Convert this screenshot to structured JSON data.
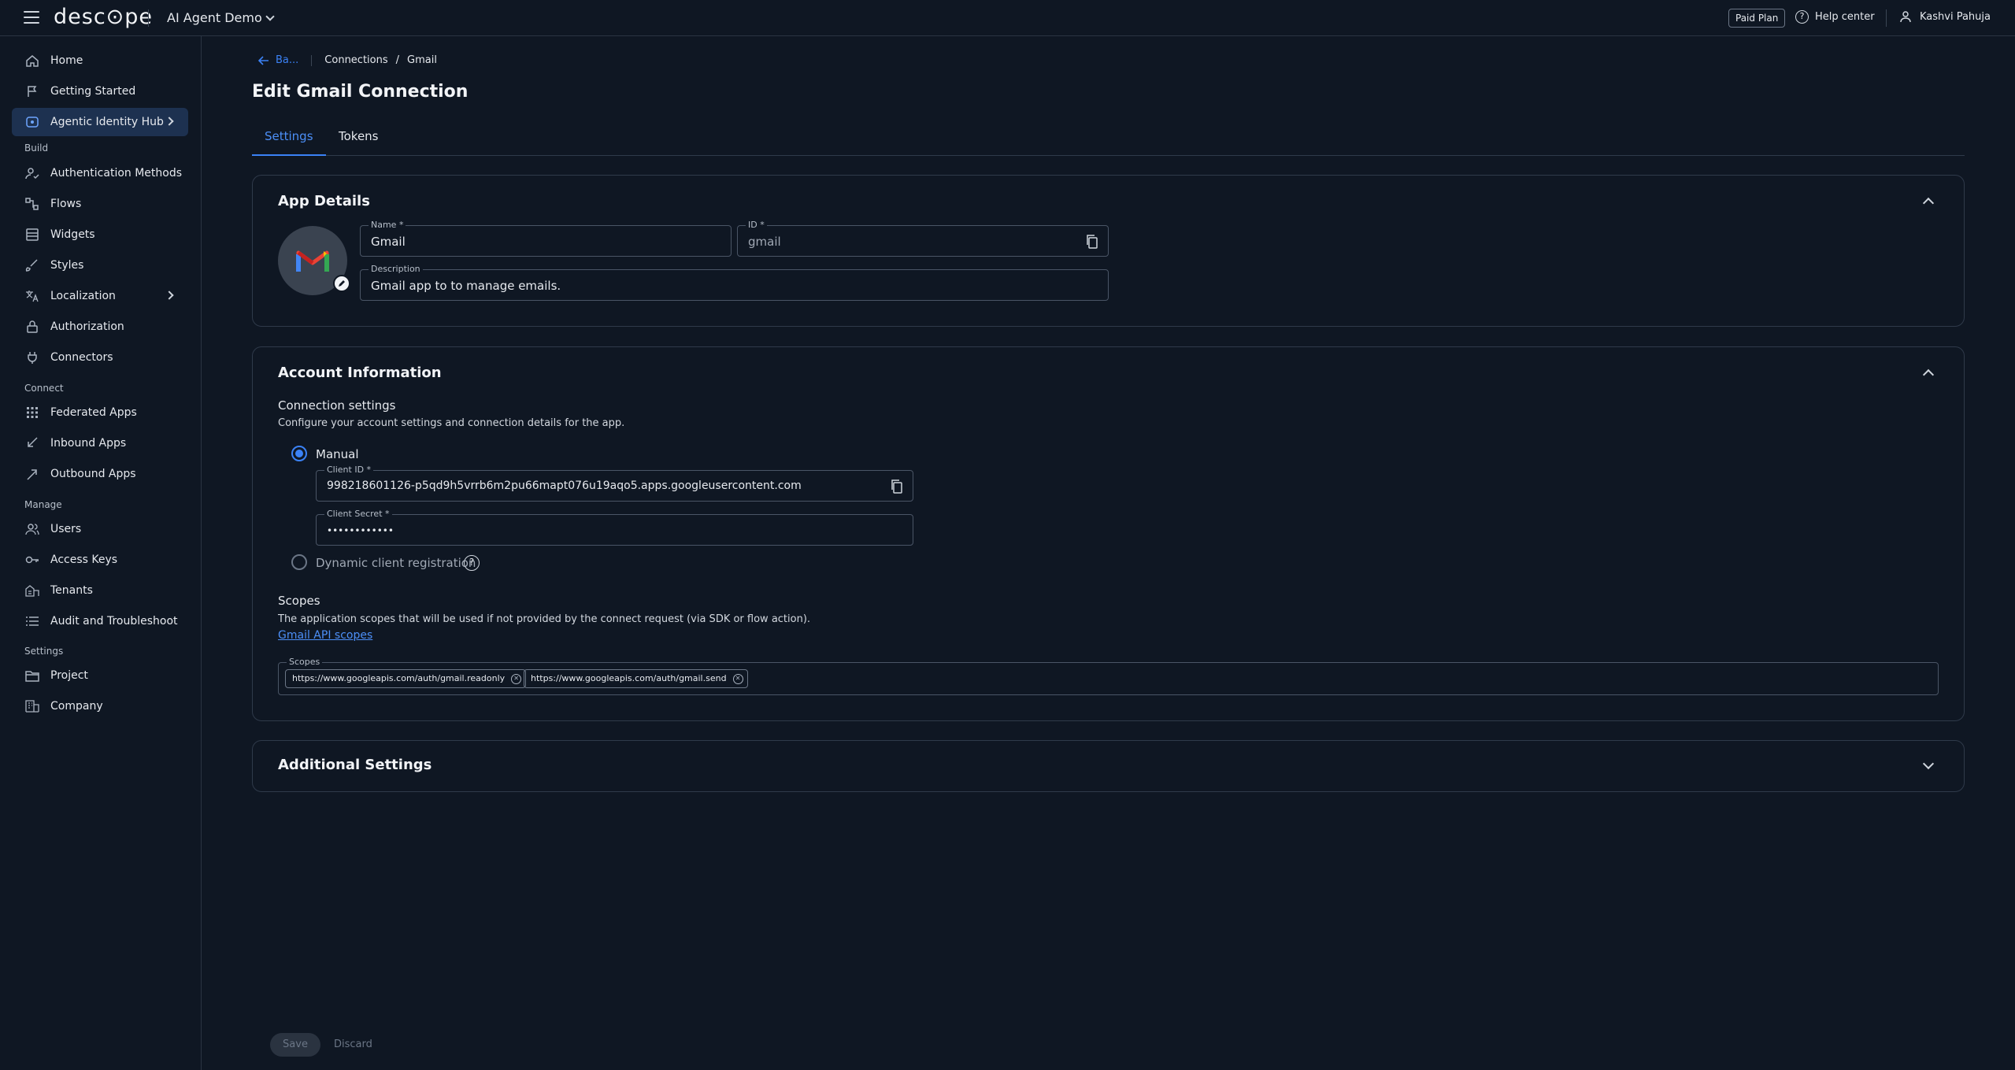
{
  "topbar": {
    "logo": "desc⊙pe",
    "project": "AI Agent Demo",
    "plan": "Paid Plan",
    "help": "Help center",
    "user": "Kashvi Pahuja"
  },
  "sidebar": {
    "items": [
      {
        "label": "Home",
        "icon": "home-icon"
      },
      {
        "label": "Getting Started",
        "icon": "flag-icon"
      },
      {
        "label": "Agentic Identity Hub",
        "icon": "agent-icon"
      },
      {
        "label": "Authentication Methods",
        "icon": "auth-icon"
      },
      {
        "label": "Flows",
        "icon": "flows-icon"
      },
      {
        "label": "Widgets",
        "icon": "widgets-icon"
      },
      {
        "label": "Styles",
        "icon": "brush-icon"
      },
      {
        "label": "Localization",
        "icon": "translate-icon"
      },
      {
        "label": "Authorization",
        "icon": "lock-icon"
      },
      {
        "label": "Connectors",
        "icon": "plug-icon"
      },
      {
        "label": "Federated Apps",
        "icon": "grid-icon"
      },
      {
        "label": "Inbound Apps",
        "icon": "inbound-icon"
      },
      {
        "label": "Outbound Apps",
        "icon": "outbound-icon"
      },
      {
        "label": "Users",
        "icon": "users-icon"
      },
      {
        "label": "Access Keys",
        "icon": "key-icon"
      },
      {
        "label": "Tenants",
        "icon": "tenants-icon"
      },
      {
        "label": "Audit and Troubleshoot",
        "icon": "list-icon"
      },
      {
        "label": "Project",
        "icon": "folder-icon"
      },
      {
        "label": "Company",
        "icon": "building-icon"
      }
    ],
    "sections": {
      "build": "Build",
      "connect": "Connect",
      "manage": "Manage",
      "settings": "Settings"
    }
  },
  "breadcrumb": {
    "back": "Ba...",
    "connections": "Connections",
    "sep": "/",
    "current": "Gmail"
  },
  "page": {
    "title": "Edit Gmail Connection"
  },
  "tabs": [
    {
      "label": "Settings"
    },
    {
      "label": "Tokens"
    }
  ],
  "app_details": {
    "title": "App Details",
    "name_label": "Name *",
    "name_value": "Gmail",
    "id_label": "ID *",
    "id_value": "gmail",
    "description_label": "Description",
    "description_value": "Gmail app to to manage emails."
  },
  "account": {
    "title": "Account Information",
    "conn_heading": "Connection settings",
    "conn_text": "Configure your account settings and connection details for the app.",
    "manual_label": "Manual",
    "client_id_label": "Client ID *",
    "client_id_value": "998218601126-p5qd9h5vrrb6m2pu66mapt076u19aqo5.apps.googleusercontent.com",
    "client_secret_label": "Client Secret *",
    "client_secret_value": "••••••••••••",
    "dynamic_label": "Dynamic client registration",
    "scopes_heading": "Scopes",
    "scopes_text": "The application scopes that will be used if not provided by the connect request (via SDK or flow action).",
    "scopes_link": "Gmail API scopes",
    "scopes_field_label": "Scopes",
    "scopes": [
      "https://www.googleapis.com/auth/gmail.readonly",
      "https://www.googleapis.com/auth/gmail.send"
    ]
  },
  "additional": {
    "title": "Additional Settings"
  },
  "footer": {
    "save": "Save",
    "discard": "Discard"
  },
  "colors": {
    "accent": "#3b82f6",
    "background": "#0f1723",
    "active_nav": "#1d3150"
  }
}
